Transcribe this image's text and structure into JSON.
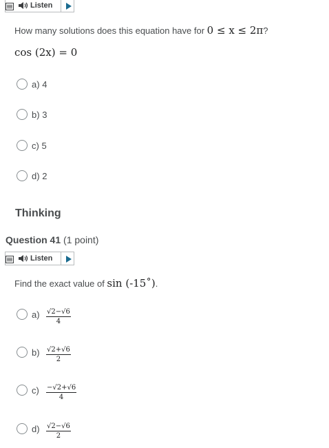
{
  "listen_label": "Listen",
  "question_40": {
    "prompt_prefix": "How many solutions does this equation have for ",
    "prompt_math": "0 ≤ x ≤ 2π",
    "prompt_suffix": "?",
    "equation": "cos (2x) = 0",
    "options": [
      {
        "letter": "a)",
        "text": "4"
      },
      {
        "letter": "b)",
        "text": "3"
      },
      {
        "letter": "c)",
        "text": "5"
      },
      {
        "letter": "d)",
        "text": "2"
      }
    ]
  },
  "section_heading": "Thinking",
  "question_41": {
    "number": "Question 41",
    "points": "(1 point)",
    "prompt_prefix": "Find the exact value of ",
    "prompt_math": "sin (-15˚)",
    "prompt_suffix": ".",
    "options": [
      {
        "letter": "a)",
        "numerator": "√2−√6",
        "denominator": "4"
      },
      {
        "letter": "b)",
        "numerator": "√2+√6",
        "denominator": "2"
      },
      {
        "letter": "c)",
        "numerator": "−√2+√6",
        "denominator": "4"
      },
      {
        "letter": "d)",
        "numerator": "√2−√6",
        "denominator": "2"
      }
    ]
  },
  "colors": {
    "play_arrow": "#1a6b8f",
    "text": "#494c4e",
    "border": "#b9bcbe"
  }
}
